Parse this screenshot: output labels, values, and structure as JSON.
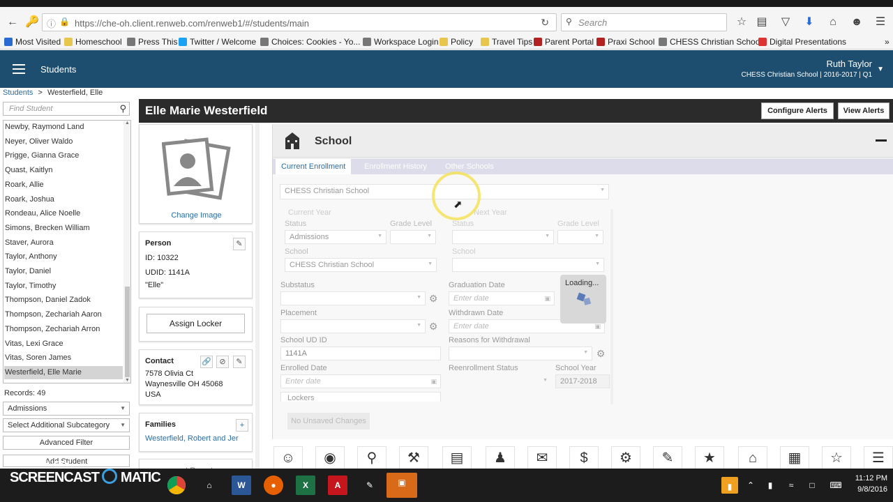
{
  "browser": {
    "url": "https://che-oh.client.renweb.com/renweb1/#/students/main",
    "search_placeholder": "Search",
    "bookmarks": [
      {
        "label": "Most Visited",
        "color": "#2a6bd1"
      },
      {
        "label": "Homeschool",
        "color": "#e8c54c"
      },
      {
        "label": "Press This",
        "color": "#777777"
      },
      {
        "label": "Twitter / Welcome",
        "color": "#1da1f2"
      },
      {
        "label": "Choices: Cookies - Yo...",
        "color": "#777777"
      },
      {
        "label": "Workspace Login",
        "color": "#777777"
      },
      {
        "label": "Policy",
        "color": "#e8c54c"
      },
      {
        "label": "Travel Tips",
        "color": "#e8c54c"
      },
      {
        "label": "Parent Portal",
        "color": "#b22222"
      },
      {
        "label": "Praxi School",
        "color": "#b22222"
      },
      {
        "label": "CHESS Christian School",
        "color": "#777777"
      },
      {
        "label": "Digital Presentations",
        "color": "#d33"
      }
    ]
  },
  "header": {
    "title": "Students",
    "user_name": "Ruth Taylor",
    "user_school": "CHESS Christian School  |  2016-2017  |  Q1"
  },
  "breadcrumb": {
    "root": "Students",
    "sep": ">",
    "current": "Westerfield, Elle"
  },
  "search": {
    "placeholder": "Find Student"
  },
  "students": [
    "Newby, Raymond Land",
    "Neyer, Oliver Waldo",
    "Prigge, Gianna Grace",
    "Quast, Kaitlyn",
    "Roark, Allie",
    "Roark, Joshua",
    "Rondeau, Alice Noelle",
    "Simons, Brecken William",
    "Staver, Aurora",
    "Taylor, Anthony",
    "Taylor, Daniel",
    "Taylor, Timothy",
    "Thompson, Daniel Zadok",
    "Thompson, Zechariah Aaron",
    "Thompson, Zechariah Arron",
    "Vitas, Lexi Grace",
    "Vitas, Soren  James",
    "Westerfield, Elle Marie"
  ],
  "records": "Records:  49",
  "filters": {
    "category": "Admissions",
    "subcategory": "Select Additional Subcategory",
    "advanced": "Advanced Filter",
    "add_student": "Add Student"
  },
  "student": {
    "name": "Elle Marie Westerfield",
    "change_image": "Change Image",
    "person_label": "Person",
    "id": "ID: 10322",
    "udid": "UDID: 1141A",
    "nickname": "\"Elle\"",
    "assign_locker": "Assign Locker",
    "contact_label": "Contact",
    "address1": "7578 Olivia Ct",
    "address2": "Waynesville OH 45068",
    "country": "USA",
    "families_label": "Families",
    "family": "Westerfield, Robert and Jer",
    "report_partial": "nt Report"
  },
  "alerts": {
    "configure": "Configure Alerts",
    "view": "View Alerts"
  },
  "school_panel": {
    "title": "School",
    "tabs": [
      "Current Enrollment",
      "Enrollment History",
      "Other Schools"
    ],
    "school_select": "CHESS Christian School",
    "current_year": "Current Year",
    "next_year": "Next Year",
    "status": "Status",
    "grade_level": "Grade Level",
    "status_value": "Admissions",
    "school": "School",
    "school_value": "CHESS Christian School",
    "substatus": "Substatus",
    "graduation_date": "Graduation Date",
    "placement": "Placement",
    "withdrawn_date": "Withdrawn Date",
    "school_ud_id": "School UD ID",
    "school_ud_id_value": "1141A",
    "reasons_withdrawal": "Reasons for Withdrawal",
    "enrolled_date": "Enrolled Date",
    "reenrollment_status": "Reenrollment Status",
    "school_year": "School Year",
    "school_year_value": "2017-2018",
    "date_placeholder": "Enter date",
    "lockers": "Lockers",
    "no_changes": "No Unsaved Changes",
    "loading": "Loading...",
    "col_partial": "C"
  },
  "taskbar": {
    "time": "11:12 PM",
    "date": "9/8/2016",
    "watermark_top": "RECORDED WITH",
    "watermark_main": "SCREENCAST",
    "watermark_suffix": "MATIC"
  }
}
